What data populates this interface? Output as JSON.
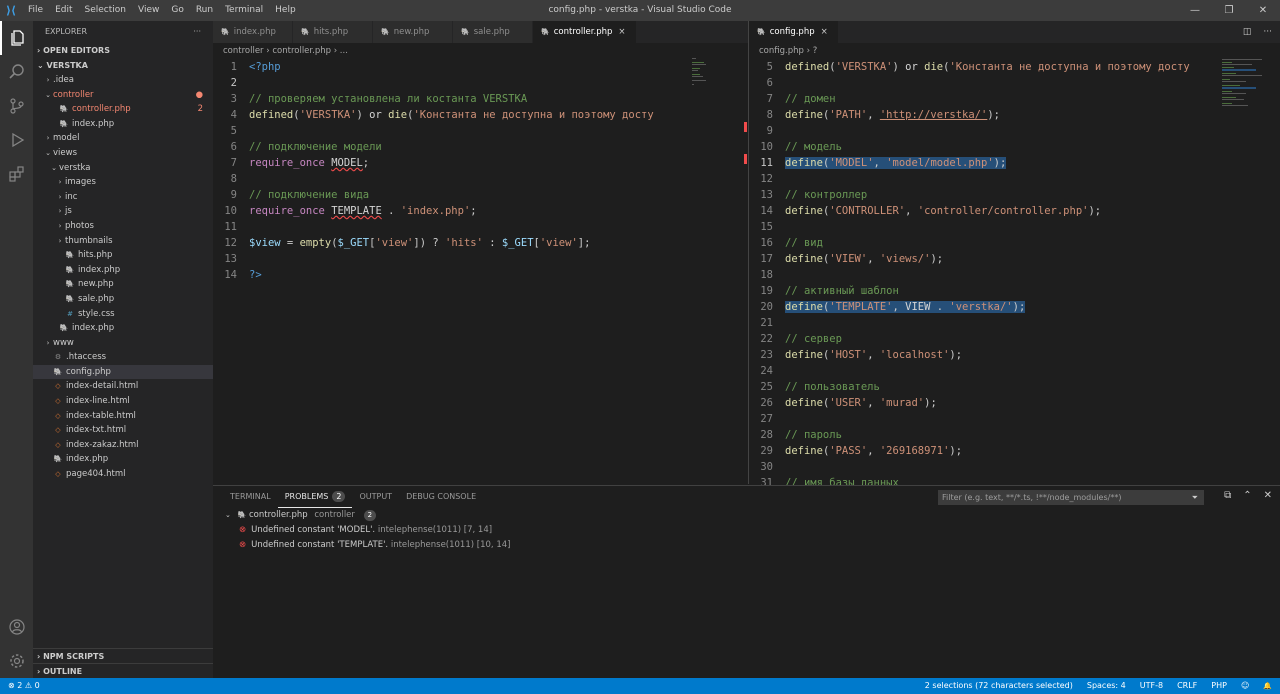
{
  "titlebar": {
    "menu": [
      "File",
      "Edit",
      "Selection",
      "View",
      "Go",
      "Run",
      "Terminal",
      "Help"
    ],
    "title": "config.php - verstka - Visual Studio Code"
  },
  "sidebar": {
    "title": "EXPLORER",
    "open_editors": "OPEN EDITORS",
    "project": "VERSTKA",
    "tree": [
      {
        "label": ".idea",
        "depth": 1,
        "type": "folder",
        "open": false
      },
      {
        "label": "controller",
        "depth": 1,
        "type": "folder",
        "open": true,
        "error": true,
        "badge": "●"
      },
      {
        "label": "controller.php",
        "depth": 2,
        "type": "php",
        "error": true,
        "badge": "2"
      },
      {
        "label": "index.php",
        "depth": 2,
        "type": "php"
      },
      {
        "label": "model",
        "depth": 1,
        "type": "folder",
        "open": false
      },
      {
        "label": "views",
        "depth": 1,
        "type": "folder",
        "open": true
      },
      {
        "label": "verstka",
        "depth": 2,
        "type": "folder",
        "open": true
      },
      {
        "label": "images",
        "depth": 3,
        "type": "folder",
        "open": false
      },
      {
        "label": "inc",
        "depth": 3,
        "type": "folder",
        "open": false
      },
      {
        "label": "js",
        "depth": 3,
        "type": "folder",
        "open": false
      },
      {
        "label": "photos",
        "depth": 3,
        "type": "folder",
        "open": false
      },
      {
        "label": "thumbnails",
        "depth": 3,
        "type": "folder",
        "open": false
      },
      {
        "label": "hits.php",
        "depth": 3,
        "type": "php"
      },
      {
        "label": "index.php",
        "depth": 3,
        "type": "php"
      },
      {
        "label": "new.php",
        "depth": 3,
        "type": "php"
      },
      {
        "label": "sale.php",
        "depth": 3,
        "type": "php"
      },
      {
        "label": "style.css",
        "depth": 3,
        "type": "css"
      },
      {
        "label": "index.php",
        "depth": 2,
        "type": "php"
      },
      {
        "label": "www",
        "depth": 1,
        "type": "folder",
        "open": false
      },
      {
        "label": ".htaccess",
        "depth": 1,
        "type": "gear"
      },
      {
        "label": "config.php",
        "depth": 1,
        "type": "php",
        "selected": true
      },
      {
        "label": "index-detail.html",
        "depth": 1,
        "type": "html"
      },
      {
        "label": "index-line.html",
        "depth": 1,
        "type": "html"
      },
      {
        "label": "index-table.html",
        "depth": 1,
        "type": "html"
      },
      {
        "label": "index-txt.html",
        "depth": 1,
        "type": "html"
      },
      {
        "label": "index-zakaz.html",
        "depth": 1,
        "type": "html"
      },
      {
        "label": "index.php",
        "depth": 1,
        "type": "php"
      },
      {
        "label": "page404.html",
        "depth": 1,
        "type": "html"
      }
    ],
    "npm_scripts": "NPM SCRIPTS",
    "outline": "OUTLINE"
  },
  "left_editor": {
    "tabs": [
      {
        "label": "index.php",
        "active": false
      },
      {
        "label": "hits.php",
        "active": false
      },
      {
        "label": "new.php",
        "active": false
      },
      {
        "label": "sale.php",
        "active": false
      },
      {
        "label": "controller.php",
        "active": true,
        "close": "×"
      }
    ],
    "breadcrumb": "controller  ›  controller.php  ›  ...",
    "lines": [
      {
        "n": "1",
        "html": "<span class=\"c-tag\">&lt;?php</span>"
      },
      {
        "n": "2",
        "html": "",
        "current": true
      },
      {
        "n": "3",
        "html": "<span class=\"c-com\">// проверяем установлена ли костанта VERSTKA</span>"
      },
      {
        "n": "4",
        "html": "<span class=\"c-fn\">defined</span>(<span class=\"c-str\">'VERSTKA'</span>) <span class=\"c-def\">or</span> <span class=\"c-fn\">die</span>(<span class=\"c-str\">'Константа не доступна и поэтому досту</span>"
      },
      {
        "n": "5",
        "html": ""
      },
      {
        "n": "6",
        "html": "<span class=\"c-com\">// подключение модели</span>"
      },
      {
        "n": "7",
        "html": "<span class=\"c-kw\">require_once</span> <span class=\"c-const squig\">MODEL</span>;"
      },
      {
        "n": "8",
        "html": ""
      },
      {
        "n": "9",
        "html": "<span class=\"c-com\">// подключение вида</span>"
      },
      {
        "n": "10",
        "html": "<span class=\"c-kw\">require_once</span> <span class=\"c-const squig\">TEMPLATE</span> . <span class=\"c-str\">'index.php'</span>;"
      },
      {
        "n": "11",
        "html": ""
      },
      {
        "n": "12",
        "html": "<span class=\"c-var\">$view</span> = <span class=\"c-fn\">empty</span>(<span class=\"c-var\">$_GET</span>[<span class=\"c-str\">'view'</span>]) ? <span class=\"c-str\">'hits'</span> : <span class=\"c-var\">$_GET</span>[<span class=\"c-str\">'view'</span>];"
      },
      {
        "n": "13",
        "html": ""
      },
      {
        "n": "14",
        "html": "<span class=\"c-tag\">?&gt;</span>"
      }
    ]
  },
  "right_editor": {
    "tab": {
      "label": "config.php",
      "close": "×"
    },
    "breadcrumb": "config.php  ›  ?",
    "lines": [
      {
        "n": "5",
        "html": "<span class=\"c-fn\">defined</span>(<span class=\"c-str\">'VERSTKA'</span>) <span class=\"c-def\">or</span> <span class=\"c-fn\">die</span>(<span class=\"c-str\">'Константа не доступна и поэтому досту</span>"
      },
      {
        "n": "6",
        "html": ""
      },
      {
        "n": "7",
        "html": "<span class=\"c-com\">// домен</span>"
      },
      {
        "n": "8",
        "html": "<span class=\"c-fn\">define</span>(<span class=\"c-str\">'PATH'</span>, <span class=\"c-str\" style=\"text-decoration:underline\">'http://verstka/'</span>);"
      },
      {
        "n": "9",
        "html": ""
      },
      {
        "n": "10",
        "html": "<span class=\"c-com\">// модель</span>"
      },
      {
        "n": "11",
        "html": "<span class=\"sel-hl\"><span class=\"c-fn\">define</span>(<span class=\"c-str\">'MODEL'</span>, <span class=\"c-str\">'model/model.php'</span>);</span>",
        "current": true
      },
      {
        "n": "12",
        "html": ""
      },
      {
        "n": "13",
        "html": "<span class=\"c-com\">// контроллер</span>"
      },
      {
        "n": "14",
        "html": "<span class=\"c-fn\">define</span>(<span class=\"c-str\">'CONTROLLER'</span>, <span class=\"c-str\">'controller/controller.php'</span>);"
      },
      {
        "n": "15",
        "html": ""
      },
      {
        "n": "16",
        "html": "<span class=\"c-com\">// вид</span>"
      },
      {
        "n": "17",
        "html": "<span class=\"c-fn\">define</span>(<span class=\"c-str\">'VIEW'</span>, <span class=\"c-str\">'views/'</span>);"
      },
      {
        "n": "18",
        "html": ""
      },
      {
        "n": "19",
        "html": "<span class=\"c-com\">// активный шаблон</span>"
      },
      {
        "n": "20",
        "html": "<span class=\"sel-hl\"><span class=\"c-fn\">define</span>(<span class=\"c-str\">'TEMPLATE'</span>, <span class=\"c-const\">VIEW</span> . <span class=\"c-str\">'verstka/'</span>);</span>"
      },
      {
        "n": "21",
        "html": ""
      },
      {
        "n": "22",
        "html": "<span class=\"c-com\">// сервер</span>"
      },
      {
        "n": "23",
        "html": "<span class=\"c-fn\">define</span>(<span class=\"c-str\">'HOST'</span>, <span class=\"c-str\">'localhost'</span>);"
      },
      {
        "n": "24",
        "html": ""
      },
      {
        "n": "25",
        "html": "<span class=\"c-com\">// пользователь</span>"
      },
      {
        "n": "26",
        "html": "<span class=\"c-fn\">define</span>(<span class=\"c-str\">'USER'</span>, <span class=\"c-str\">'murad'</span>);"
      },
      {
        "n": "27",
        "html": ""
      },
      {
        "n": "28",
        "html": "<span class=\"c-com\">// пароль</span>"
      },
      {
        "n": "29",
        "html": "<span class=\"c-fn\">define</span>(<span class=\"c-str\">'PASS'</span>, <span class=\"c-str\">'269168971'</span>);"
      },
      {
        "n": "30",
        "html": ""
      },
      {
        "n": "31",
        "html": "<span class=\"c-com\">// имя базы данных</span>"
      }
    ]
  },
  "panel": {
    "tabs": [
      {
        "label": "TERMINAL",
        "active": false
      },
      {
        "label": "PROBLEMS",
        "active": true,
        "count": "2"
      },
      {
        "label": "OUTPUT",
        "active": false
      },
      {
        "label": "DEBUG CONSOLE",
        "active": false
      }
    ],
    "filter_placeholder": "Filter (e.g. text, **/*.ts, !**/node_modules/**)",
    "file": {
      "name": "controller.php",
      "folder": "controller",
      "count": "2"
    },
    "problems": [
      {
        "message": "Undefined constant 'MODEL'.",
        "source": "intelephense(1011)",
        "pos": "[7, 14]"
      },
      {
        "message": "Undefined constant 'TEMPLATE'.",
        "source": "intelephense(1011)",
        "pos": "[10, 14]"
      }
    ]
  },
  "statusbar": {
    "errors": "⊗ 2  ⚠ 0",
    "selections": "2 selections (72 characters selected)",
    "spaces": "Spaces: 4",
    "encoding": "UTF-8",
    "eol": "CRLF",
    "language": "PHP",
    "feedback_icon": "☺",
    "bell_icon": "🔔"
  }
}
